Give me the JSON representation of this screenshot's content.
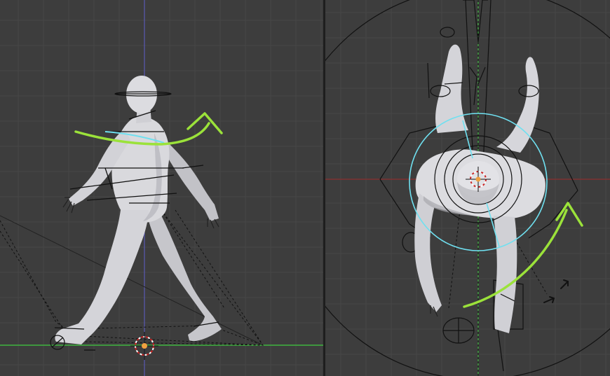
{
  "app": {
    "panels": [
      {
        "id": "front",
        "view": "side-view-3d-viewport",
        "background": "#3d3d3d"
      },
      {
        "id": "top",
        "view": "top-view-3d-viewport",
        "background": "#3d3d3d"
      }
    ],
    "colors": {
      "grid": "#474747",
      "grid_major": "#4a4a4a",
      "axis_x": "#8c2f2f",
      "axis_y": "#3fb53f",
      "axis_z": "#5a5ab4",
      "mesh": "#d9d9dd",
      "mesh_shade": "#a8a8ae",
      "bone_lines": "#111111",
      "selection_circle": "#6fe0f0",
      "annotation_arrow": "#9be23a",
      "cursor_ring": "#cc2222",
      "cursor_center": "#f0a040",
      "divider": "#1e1e1e"
    },
    "icons": [
      "rotation-arrow-icon",
      "3d-cursor-icon",
      "rotate-cursor-icon"
    ]
  }
}
